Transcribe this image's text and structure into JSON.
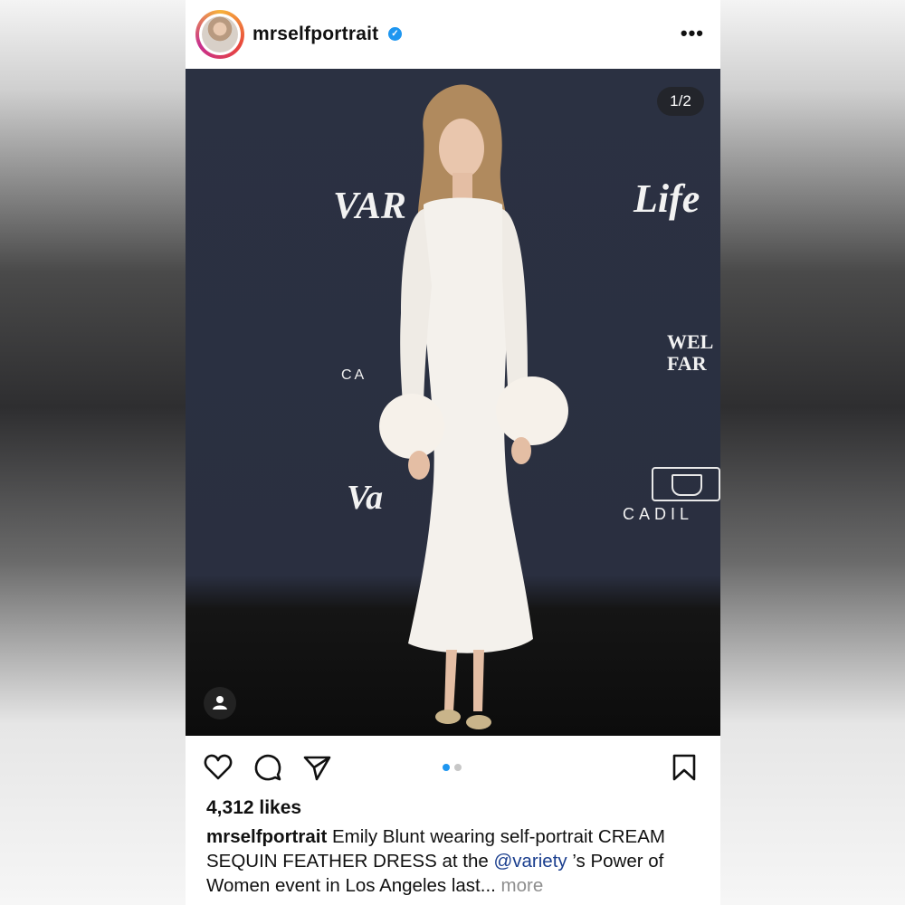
{
  "post": {
    "username": "mrselfportrait",
    "verified_mark": "✓",
    "more_icon": "more-horizontal-icon",
    "more_glyph": "•••"
  },
  "photo": {
    "counter": "1/2",
    "backdrop": {
      "variety_top": "VAR",
      "life": "Life",
      "wells": "WEL FAR",
      "cadi_left": "CA",
      "variety_bottom": "Va",
      "cadillac": "CADIL"
    },
    "tag_icon": "person-tag-icon"
  },
  "actions": {
    "like_icon": "heart-icon",
    "comment_icon": "comment-icon",
    "share_icon": "send-icon",
    "save_icon": "bookmark-icon",
    "carousel_active_color": "#1e96f0",
    "carousel_inactive_color": "#c7c7c7"
  },
  "likes": "4,312 likes",
  "caption": {
    "username": "mrselfportrait",
    "text_1": " Emily Blunt wearing self-portrait CREAM SEQUIN FEATHER DRESS at the ",
    "mention": "@variety",
    "text_2": " ’s Power of Women event in Los Angeles last...",
    "more": " more"
  }
}
